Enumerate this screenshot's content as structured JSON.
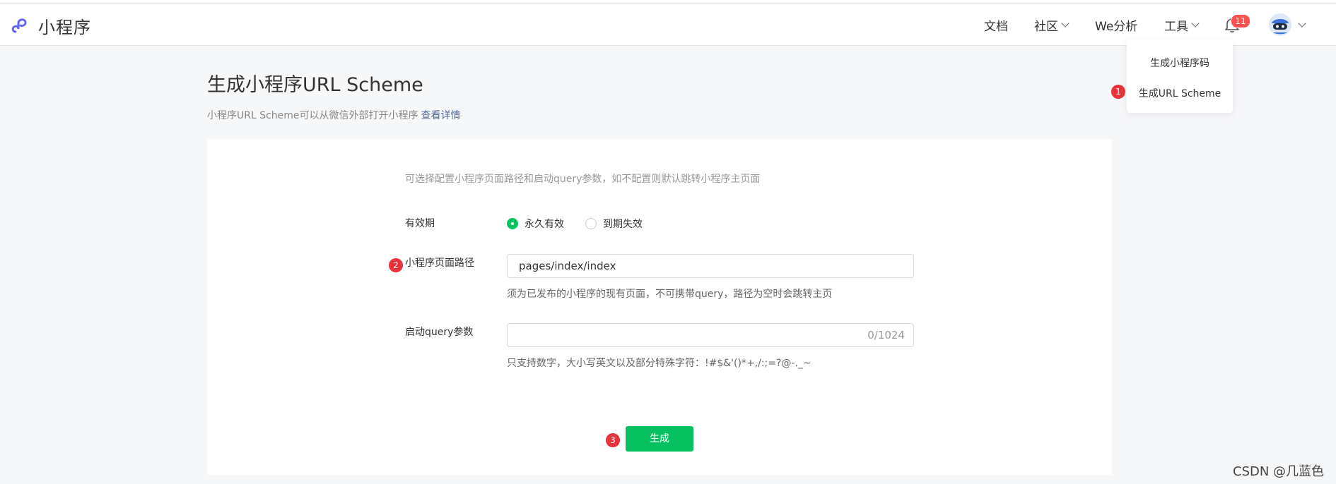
{
  "app": {
    "title": "小程序"
  },
  "nav": {
    "docs": "文档",
    "community": "社区",
    "analytics": "We分析",
    "tools": "工具",
    "notification_count": "11"
  },
  "tools_menu": {
    "items": [
      "生成小程序码",
      "生成URL Scheme"
    ]
  },
  "page": {
    "title": "生成小程序URL Scheme",
    "subtitle": "小程序URL Scheme可以从微信外部打开小程序",
    "details_link": "查看详情"
  },
  "form": {
    "hint": "可选择配置小程序页面路径和启动query参数，如不配置则默认跳转小程序主页面",
    "validity": {
      "label": "有效期",
      "options": [
        "永久有效",
        "到期失效"
      ],
      "selected": "永久有效"
    },
    "path": {
      "label": "小程序页面路径",
      "value": "pages/index/index",
      "help": "须为已发布的小程序的现有页面，不可携带query，路径为空时会跳转主页"
    },
    "query": {
      "label": "启动query参数",
      "value": "",
      "counter": "0/1024",
      "help": "只支持数字，大小写英文以及部分特殊字符：!#$&'()*+,/:;=?@-._~"
    },
    "submit_label": "生成"
  },
  "markers": [
    "1",
    "2",
    "3"
  ],
  "watermark": "CSDN @几蓝色",
  "colors": {
    "accent": "#07c160",
    "badge": "#fa5151",
    "marker": "#e8323c",
    "link": "#576b95"
  }
}
